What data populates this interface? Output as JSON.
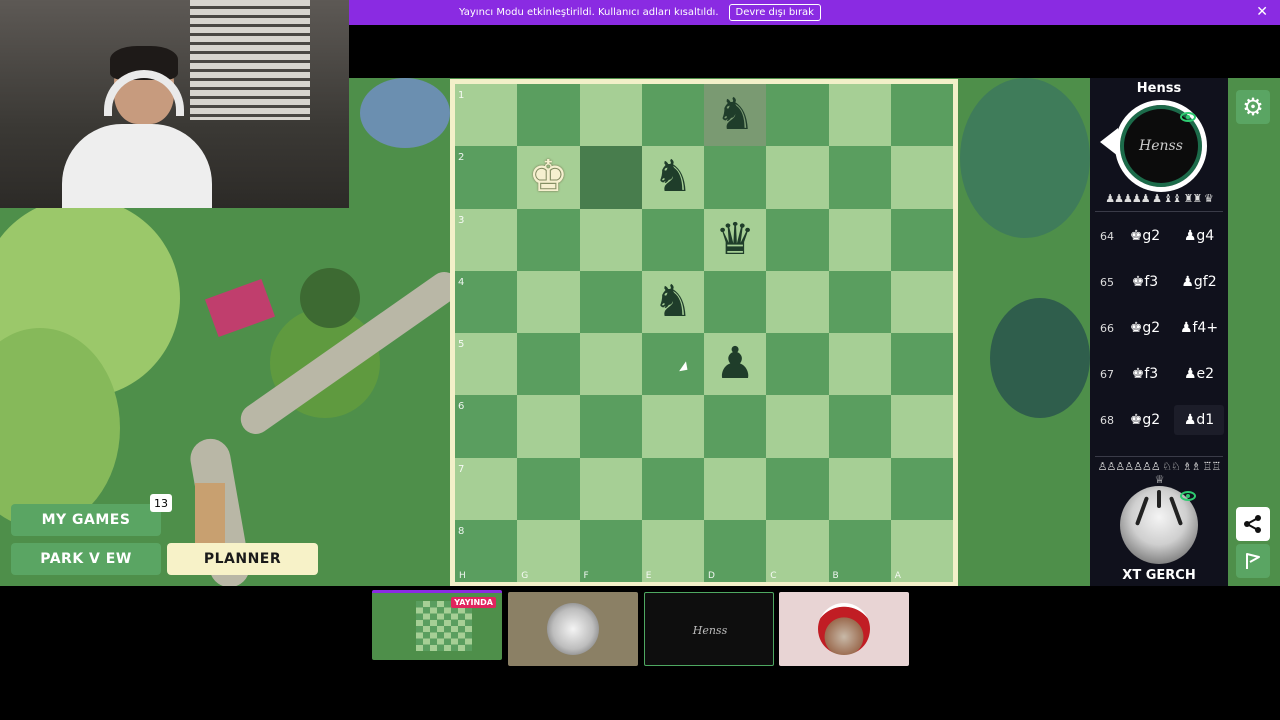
{
  "banner": {
    "text": "Yayıncı Modu etkinleştirildi. Kullanıcı adları kısaltıldı.",
    "button_label": "Devre dışı bırak",
    "close_glyph": "✕",
    "color": "#8a2be2"
  },
  "left_menu": {
    "my_games_label": "MY GAMES",
    "my_games_badge": "13",
    "park_view_label": "PARK V EW",
    "planner_label": "PLANNER"
  },
  "board": {
    "ranks": [
      "1",
      "2",
      "3",
      "4",
      "5",
      "6",
      "7",
      "8"
    ],
    "files": [
      "H",
      "G",
      "F",
      "E",
      "D",
      "C",
      "B",
      "A"
    ],
    "light_color": "#a6cf95",
    "dark_color": "#5a9e5f",
    "pieces": [
      {
        "square": "D1",
        "glyph": "♞",
        "color": "black"
      },
      {
        "square": "G2",
        "glyph": "♚",
        "color": "white"
      },
      {
        "square": "E2",
        "glyph": "♞",
        "color": "black"
      },
      {
        "square": "D3",
        "glyph": "♛",
        "color": "black"
      },
      {
        "square": "E4",
        "glyph": "♞",
        "color": "black"
      },
      {
        "square": "D5",
        "glyph": "♟",
        "color": "black"
      }
    ],
    "highlights": [
      "D1",
      "F2"
    ]
  },
  "opponent": {
    "name": "Henss",
    "avatar_text": "Henss",
    "captured": "♟♟♟♟♟ ♟ ♝♝ ♜♜ ♛"
  },
  "moves": [
    {
      "num": "64",
      "white": "♚g2",
      "black": "♟g4"
    },
    {
      "num": "65",
      "white": "♚f3",
      "black": "♟gf2"
    },
    {
      "num": "66",
      "white": "♚g2",
      "black": "♟f4+"
    },
    {
      "num": "67",
      "white": "♚f3",
      "black": "♟e2"
    },
    {
      "num": "68",
      "white": "♚g2",
      "black": "♟d1"
    }
  ],
  "player": {
    "name": "XT GERCH",
    "captured": "♙♙♙♙♙♙♙ ♘♘ ♗♗ ♖♖ ♕"
  },
  "icons": {
    "gear": "⚙",
    "share": "share-icon",
    "flag": "flag-icon"
  },
  "thumbnails": {
    "live_badge": "YAYINDA",
    "henss_text": "Henss"
  }
}
